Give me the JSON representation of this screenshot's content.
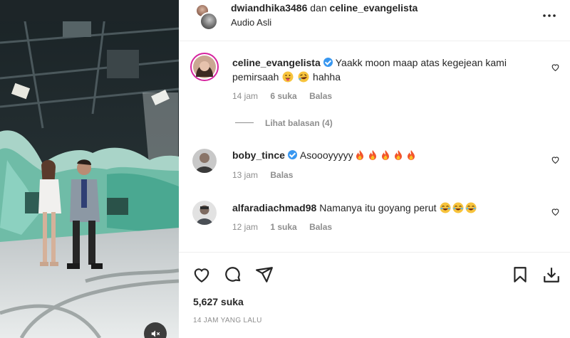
{
  "header": {
    "user1": "dwiandhika3486",
    "joiner": "dan",
    "user2": "celine_evangelista",
    "audio": "Audio Asli"
  },
  "comments": [
    {
      "username": "celine_evangelista",
      "verified": true,
      "text_before": "Yaakk moon maap atas kegejean kami pemirsaah",
      "text_after": "hahha",
      "emojis": [
        "tongue-face-emoji",
        "rolling-laughing-emoji"
      ],
      "time": "14 jam",
      "likes": "6 suka",
      "reply": "Balas",
      "view_replies": "Lihat balasan (4)"
    },
    {
      "username": "boby_tince",
      "verified": true,
      "text_before": "Asoooyyyyy",
      "emojis": [
        "fire-emoji",
        "fire-emoji",
        "fire-emoji",
        "fire-emoji",
        "fire-emoji"
      ],
      "time": "13 jam",
      "reply": "Balas"
    },
    {
      "username": "alfaradiachmad98",
      "verified": false,
      "text_before": "Namanya itu goyang perut",
      "emojis": [
        "joy-emoji",
        "joy-emoji",
        "joy-emoji"
      ],
      "time": "12 jam",
      "likes": "1 suka",
      "reply": "Balas"
    }
  ],
  "footer": {
    "likes": "5,627 suka",
    "time_ago": "14 JAM YANG LALU"
  },
  "colors": {
    "text": "#262626",
    "muted": "#8e8e8e",
    "verified": "#3897f0",
    "divider": "#efefef"
  },
  "icons": [
    "heart-icon",
    "comment-icon",
    "share-icon",
    "bookmark-icon",
    "download-icon",
    "more-icon",
    "mute-icon"
  ]
}
